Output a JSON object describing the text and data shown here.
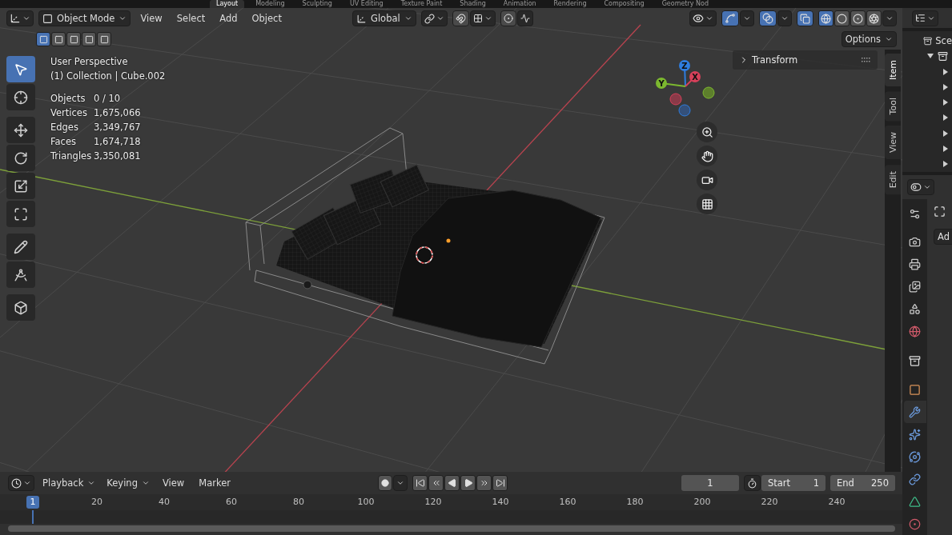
{
  "workspace_tabs": [
    {
      "label": "Layout",
      "selected": true
    },
    {
      "label": "Modeling",
      "selected": false
    },
    {
      "label": "Sculpting",
      "selected": false
    },
    {
      "label": "UV Editing",
      "selected": false
    },
    {
      "label": "Texture Paint",
      "selected": false
    },
    {
      "label": "Shading",
      "selected": false
    },
    {
      "label": "Animation",
      "selected": false
    },
    {
      "label": "Rendering",
      "selected": false
    },
    {
      "label": "Compositing",
      "selected": false
    },
    {
      "label": "Geometry Nod",
      "selected": false
    }
  ],
  "header": {
    "mode": "Object Mode",
    "menus": [
      "View",
      "Select",
      "Add",
      "Object"
    ],
    "orientation": "Global",
    "options": "Options",
    "snap": {
      "on": false
    },
    "proportional": {
      "on": false
    },
    "gizmos": {
      "on": true
    },
    "overlays": {
      "on": true
    },
    "xray": {
      "on": true
    }
  },
  "select_modes": [
    {
      "selected": true
    },
    {
      "selected": false
    },
    {
      "selected": false
    },
    {
      "selected": false
    },
    {
      "selected": false
    }
  ],
  "shading_modes": [
    {
      "kind": "wireframe",
      "selected": true
    },
    {
      "kind": "solid",
      "selected": false
    },
    {
      "kind": "material",
      "selected": false
    },
    {
      "kind": "rendered",
      "selected": false
    }
  ],
  "tools": [
    {
      "kind": "select",
      "selected": true
    },
    {
      "kind": "cursor",
      "selected": false
    },
    {
      "kind": "move",
      "selected": false
    },
    {
      "kind": "rotate",
      "selected": false
    },
    {
      "kind": "scale",
      "selected": false
    },
    {
      "kind": "transform",
      "selected": false
    },
    {
      "kind": "annotate",
      "selected": false
    },
    {
      "kind": "measure",
      "selected": false
    },
    {
      "kind": "add_cube",
      "selected": false
    }
  ],
  "stats": {
    "view": "User Perspective",
    "object": "(1) Collection | Cube.002",
    "rows": [
      {
        "label": "Objects",
        "value": "0 / 10"
      },
      {
        "label": "Vertices",
        "value": "1,675,066"
      },
      {
        "label": "Edges",
        "value": "3,349,767"
      },
      {
        "label": "Faces",
        "value": "1,674,718"
      },
      {
        "label": "Triangles",
        "value": "3,350,081"
      }
    ]
  },
  "gizmo": {
    "axes": [
      {
        "label": "Z"
      },
      {
        "label": "X"
      },
      {
        "label": "Y"
      }
    ]
  },
  "sidebar": {
    "panel": {
      "title": "Transform",
      "expanded": false
    },
    "tabs": [
      {
        "label": "Item",
        "selected": true
      },
      {
        "label": "Tool",
        "selected": false
      },
      {
        "label": "View",
        "selected": false
      },
      {
        "label": "Edit",
        "selected": false
      }
    ]
  },
  "outliner": {
    "title": "Sce",
    "tree": [
      {
        "expanded": true,
        "children": [
          {
            "expanded": false
          },
          {
            "expanded": false
          },
          {
            "expanded": false
          },
          {
            "expanded": false
          },
          {
            "expanded": false
          },
          {
            "expanded": false
          },
          {
            "expanded": false
          }
        ]
      }
    ]
  },
  "properties": {
    "add_button": "Ad",
    "tabs": [
      {
        "kind": "tool",
        "selected": false
      },
      {
        "kind": "render",
        "selected": false
      },
      {
        "kind": "output",
        "selected": false
      },
      {
        "kind": "view_layer",
        "selected": false
      },
      {
        "kind": "scene",
        "selected": false
      },
      {
        "kind": "world",
        "selected": false
      },
      {
        "kind": "collection",
        "selected": false
      },
      {
        "kind": "object",
        "selected": false
      },
      {
        "kind": "modifiers",
        "selected": true
      },
      {
        "kind": "particles",
        "selected": false
      },
      {
        "kind": "physics",
        "selected": false
      },
      {
        "kind": "constraints",
        "selected": false
      },
      {
        "kind": "data",
        "selected": false
      },
      {
        "kind": "material",
        "selected": false
      }
    ]
  },
  "timeline": {
    "menus": [
      {
        "label": "Playback",
        "dropdown": true
      },
      {
        "label": "Keying",
        "dropdown": true
      },
      {
        "label": "View",
        "dropdown": false
      },
      {
        "label": "Marker",
        "dropdown": false
      }
    ],
    "auto_keying": {
      "on": false
    },
    "current_frame": "1",
    "start": {
      "label": "Start",
      "value": "1"
    },
    "end": {
      "label": "End",
      "value": "250"
    },
    "ruler": {
      "current": "1",
      "ticks": [
        "20",
        "40",
        "60",
        "80",
        "100",
        "120",
        "140",
        "160",
        "180",
        "200",
        "220",
        "240"
      ]
    }
  }
}
